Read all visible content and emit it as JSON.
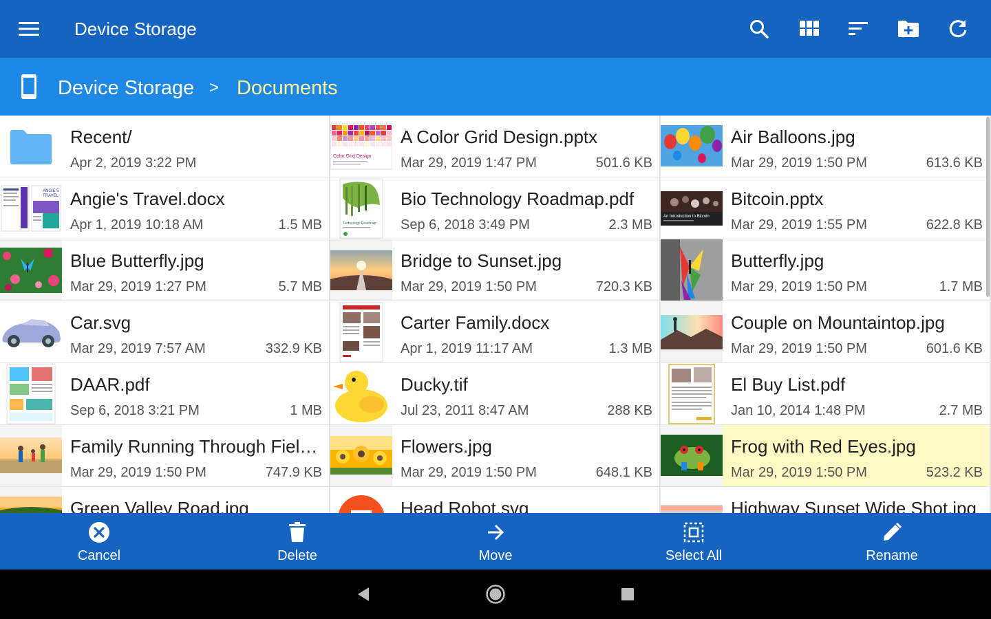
{
  "appbar": {
    "title": "Device Storage",
    "icons": [
      "menu-icon",
      "search-icon",
      "grid-view-icon",
      "sort-icon",
      "new-folder-icon",
      "refresh-icon"
    ]
  },
  "breadcrumb": {
    "icon": "phone-icon",
    "root": "Device Storage",
    "separator": ">",
    "current": "Documents"
  },
  "colors": {
    "appbar": "#1565c0",
    "breadcrumb_bar": "#1e88e5",
    "breadcrumb_current": "#fff59d",
    "selected_row": "#fff9c4",
    "folder": "#64b5f6"
  },
  "files": [
    {
      "name": "Recent/",
      "date": "Apr 2, 2019 3:22 PM",
      "size": "",
      "thumb": "folder-icon",
      "selected": false
    },
    {
      "name": "A Color Grid Design.pptx",
      "date": "Mar 29, 2019 1:47 PM",
      "size": "501.6 KB",
      "thumb": "presentation-thumbnail",
      "thumb_text": "Color Grid Design",
      "selected": false
    },
    {
      "name": "Air Balloons.jpg",
      "date": "Mar 29, 2019 1:50 PM",
      "size": "613.6 KB",
      "thumb": "image-thumbnail",
      "selected": false
    },
    {
      "name": "Angie's Travel.docx",
      "date": "Apr 1, 2019 10:18 AM",
      "size": "1.5 MB",
      "thumb": "document-thumbnail",
      "selected": false
    },
    {
      "name": "Bio Technology Roadmap.pdf",
      "date": "Sep 6, 2018 3:49 PM",
      "size": "2.3 MB",
      "thumb": "document-thumbnail",
      "selected": false
    },
    {
      "name": "Bitcoin.pptx",
      "date": "Mar 29, 2019 1:55 PM",
      "size": "622.8 KB",
      "thumb": "presentation-thumbnail",
      "thumb_text": "An Introduction to Bitcoin",
      "selected": false
    },
    {
      "name": "Blue Butterfly.jpg",
      "date": "Mar 29, 2019 1:27 PM",
      "size": "5.7 MB",
      "thumb": "image-thumbnail",
      "selected": false
    },
    {
      "name": "Bridge to Sunset.jpg",
      "date": "Mar 29, 2019 1:50 PM",
      "size": "720.3 KB",
      "thumb": "image-thumbnail",
      "selected": false
    },
    {
      "name": "Butterfly.jpg",
      "date": "Mar 29, 2019 1:50 PM",
      "size": "1.7 MB",
      "thumb": "image-thumbnail",
      "selected": false
    },
    {
      "name": "Car.svg",
      "date": "Mar 29, 2019 7:57 AM",
      "size": "332.9 KB",
      "thumb": "image-thumbnail",
      "selected": false
    },
    {
      "name": "Carter Family.docx",
      "date": "Apr 1, 2019 11:17 AM",
      "size": "1.3 MB",
      "thumb": "document-thumbnail",
      "selected": false
    },
    {
      "name": "Couple on Mountaintop.jpg",
      "date": "Mar 29, 2019 1:50 PM",
      "size": "601.6 KB",
      "thumb": "image-thumbnail",
      "selected": false
    },
    {
      "name": "DAAR.pdf",
      "date": "Sep 6, 2018 3:21 PM",
      "size": "1 MB",
      "thumb": "document-thumbnail",
      "selected": false
    },
    {
      "name": "Ducky.tif",
      "date": "Jul 23, 2011 8:47 AM",
      "size": "288 KB",
      "thumb": "image-thumbnail",
      "selected": false
    },
    {
      "name": "El Buy List.pdf",
      "date": "Jan 10, 2014 1:48 PM",
      "size": "2.7 MB",
      "thumb": "document-thumbnail",
      "selected": false
    },
    {
      "name": "Family Running Through Fiel…",
      "date": "Mar 29, 2019 1:50 PM",
      "size": "747.9 KB",
      "thumb": "image-thumbnail",
      "selected": false
    },
    {
      "name": "Flowers.jpg",
      "date": "Mar 29, 2019 1:50 PM",
      "size": "648.1 KB",
      "thumb": "image-thumbnail",
      "selected": false
    },
    {
      "name": "Frog with Red Eyes.jpg",
      "date": "Mar 29, 2019 1:50 PM",
      "size": "523.2 KB",
      "thumb": "image-thumbnail",
      "selected": true
    },
    {
      "name": "Green Valley Road.jpg",
      "date": "",
      "size": "",
      "thumb": "image-thumbnail",
      "selected": false
    },
    {
      "name": "Head Robot.svg",
      "date": "",
      "size": "",
      "thumb": "image-thumbnail",
      "selected": false
    },
    {
      "name": "Highway Sunset Wide Shot.jpg",
      "date": "",
      "size": "",
      "thumb": "image-thumbnail",
      "selected": false
    }
  ],
  "actions": [
    {
      "label": "Cancel",
      "icon": "cancel-icon"
    },
    {
      "label": "Delete",
      "icon": "trash-icon"
    },
    {
      "label": "Move",
      "icon": "arrow-right-icon"
    },
    {
      "label": "Select All",
      "icon": "select-all-icon"
    },
    {
      "label": "Rename",
      "icon": "pencil-icon"
    }
  ],
  "navigation": {
    "buttons": [
      "back-icon",
      "home-icon",
      "recents-icon"
    ]
  }
}
